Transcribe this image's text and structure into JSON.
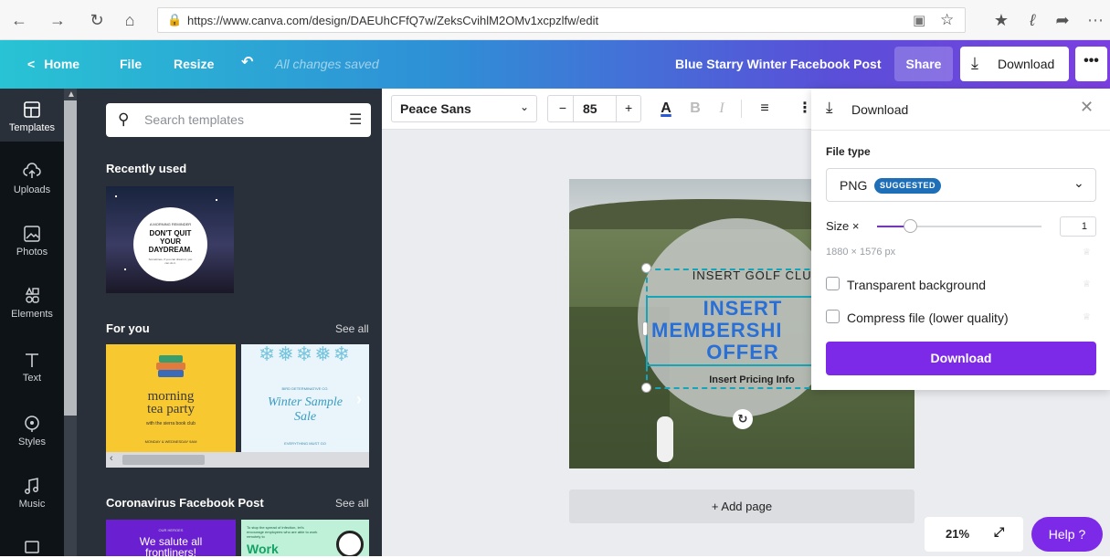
{
  "browser": {
    "url": "https://www.canva.com/design/DAEUhCFfQ7w/ZeksCvihlM2OMv1xcpzlfw/edit"
  },
  "header": {
    "home": "Home",
    "file": "File",
    "resize": "Resize",
    "saved_status": "All changes saved",
    "design_title": "Blue Starry Winter Facebook Post",
    "share": "Share",
    "download": "Download",
    "more": "•••"
  },
  "rail": {
    "items": [
      {
        "label": "Templates",
        "icon": "templates-icon"
      },
      {
        "label": "Uploads",
        "icon": "upload-cloud-icon"
      },
      {
        "label": "Photos",
        "icon": "photo-icon"
      },
      {
        "label": "Elements",
        "icon": "shapes-icon"
      },
      {
        "label": "Text",
        "icon": "text-icon"
      },
      {
        "label": "Styles",
        "icon": "palette-icon"
      },
      {
        "label": "Music",
        "icon": "music-icon"
      }
    ]
  },
  "panel": {
    "search_placeholder": "Search templates",
    "recently_used": "Recently used",
    "recent_card": {
      "small": "A MORNING REMINDER",
      "line1": "DON'T QUIT",
      "line2": "YOUR",
      "line3": "DAYDREAM.",
      "sub": "Sometimes, if you can dream it, you can do it."
    },
    "for_you": "For you",
    "for_you_see_all": "See all",
    "card_morning": {
      "line1": "morning",
      "line2": "tea party",
      "line3": "with the sierra book club",
      "footer": "MONDAY & WEDNESDAY 9AM"
    },
    "card_winter": {
      "top": "BIRD DETERMINATIVE CO.",
      "line1": "Winter Sample",
      "line2": "Sale",
      "footer": "EVERYTHING MUST GO"
    },
    "coronavirus": "Coronavirus Facebook Post",
    "coronavirus_see_all": "See all",
    "card_salute": {
      "top": "OUR HEROES",
      "line1": "We salute all",
      "line2": "frontliners!"
    },
    "card_work": {
      "top": "To stop the spread of infection, let's encourage employees who are able to work remotely to",
      "line1": "Work"
    }
  },
  "toolbar": {
    "font": "Peace Sans",
    "minus": "−",
    "size": "85",
    "plus": "+",
    "bold": "B",
    "italic": "I"
  },
  "design": {
    "club": "INSERT GOLF CLUB",
    "offer1": "INSERT",
    "offer2": "MEMBERSHI",
    "offer3": "OFFER",
    "pricing": "Insert Pricing Info"
  },
  "canvas": {
    "add_page": "+ Add page",
    "zoom": "21%",
    "help": "Help ?"
  },
  "download_panel": {
    "title": "Download",
    "file_type_label": "File type",
    "file_type": "PNG",
    "suggested": "SUGGESTED",
    "size_label": "Size ×",
    "size_value": "1",
    "size_fraction": 0.2,
    "dimensions": "1880 × 1576 px",
    "transparent": "Transparent background",
    "compress": "Compress file (lower quality)",
    "download_button": "Download"
  },
  "colors": {
    "brand_purple": "#7d2ae8",
    "teal": "#28c3d4",
    "panel_dark": "#293039",
    "suggested_badge": "#1e6fb8"
  }
}
